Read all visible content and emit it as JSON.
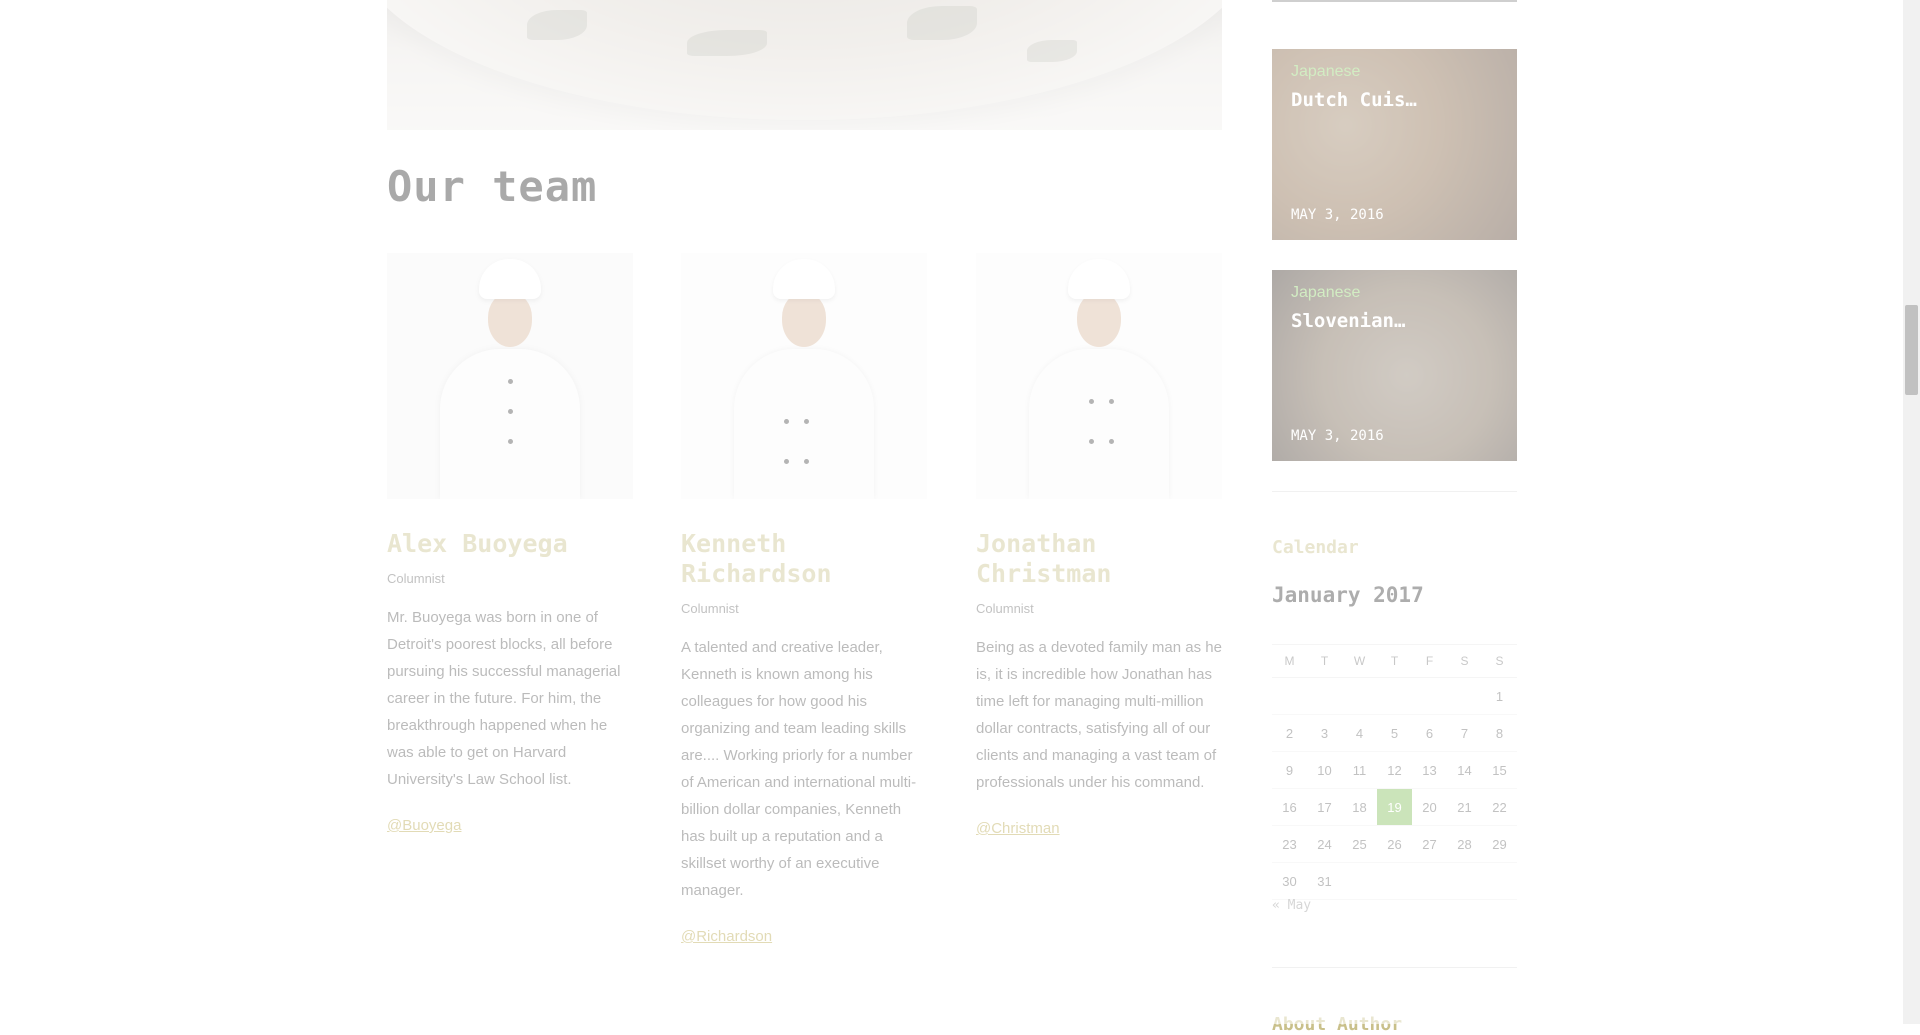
{
  "section": {
    "title": "Our team"
  },
  "team": [
    {
      "name": "Alex Buoyega",
      "role": "Columnist",
      "bio": "Mr. Buoyega was born in one of Detroit's poorest blocks, all before pursuing his successful managerial career in the future. For him, the breakthrough happened when he was able to get on Harvard University's Law School list.",
      "handle": "@Buoyega"
    },
    {
      "name": "Kenneth Richardson",
      "role": "Columnist",
      "bio": "A talented and creative leader, Kenneth is known among his colleagues for how good his organizing and team leading skills are.... Working priorly for a number of American and international multi-billion dollar companies, Kenneth has built up a reputation and a skillset worthy of an executive manager.",
      "handle": "@Richardson"
    },
    {
      "name": "Jonathan Christman",
      "role": "Columnist",
      "bio": "Being as a devoted family man as he is, it is incredible how Jonathan has time left for managing multi-million dollar contracts, satisfying all of our clients and managing a vast team of professionals under his command.",
      "handle": "@Christman"
    }
  ],
  "sidebar": {
    "posts": [
      {
        "category": "Japanese",
        "title": "Dutch Cuis…",
        "date": "MAY 3, 2016"
      },
      {
        "category": "Japanese",
        "title": "Slovenian…",
        "date": "MAY 3, 2016"
      }
    ],
    "calendar": {
      "heading": "Calendar",
      "month": "January 2017",
      "weekdays": [
        "M",
        "T",
        "W",
        "T",
        "F",
        "S",
        "S"
      ],
      "weeks": [
        [
          "",
          "",
          "",
          "",
          "",
          "",
          "1"
        ],
        [
          "2",
          "3",
          "4",
          "5",
          "6",
          "7",
          "8"
        ],
        [
          "9",
          "10",
          "11",
          "12",
          "13",
          "14",
          "15"
        ],
        [
          "16",
          "17",
          "18",
          "19",
          "20",
          "21",
          "22"
        ],
        [
          "23",
          "24",
          "25",
          "26",
          "27",
          "28",
          "29"
        ],
        [
          "30",
          "31",
          "",
          "",
          "",
          "",
          ""
        ]
      ],
      "today": "19",
      "prev_link": "« May"
    },
    "about_heading": "About Author"
  },
  "colors": {
    "accent_green": "#7dbb54",
    "category_green": "#8fd16a",
    "name_gold": "#c9c08a"
  }
}
